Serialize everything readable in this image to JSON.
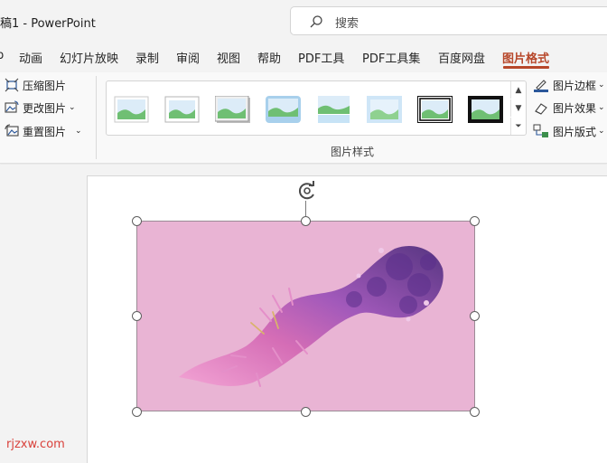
{
  "titlebar": {
    "doc_title": "稿1  -  PowerPoint",
    "search_placeholder": "搜索"
  },
  "tabs": [
    {
      "label": "b"
    },
    {
      "label": "动画"
    },
    {
      "label": "幻灯片放映"
    },
    {
      "label": "录制"
    },
    {
      "label": "审阅"
    },
    {
      "label": "视图"
    },
    {
      "label": "帮助"
    },
    {
      "label": "PDF工具"
    },
    {
      "label": "PDF工具集"
    },
    {
      "label": "百度网盘"
    },
    {
      "label": "图片格式",
      "active": true
    }
  ],
  "ribbon": {
    "adjust": {
      "compress": "压缩图片",
      "change": "更改图片",
      "reset": "重置图片"
    },
    "gallery_label": "图片样式",
    "right": {
      "border": "图片边框",
      "effects": "图片效果",
      "layout": "图片版式"
    }
  },
  "colors": {
    "accent": "#b7472a",
    "picture_bg": "#e9b4d4",
    "watermark": "#d9413b"
  },
  "watermark": "rjzxw.com"
}
